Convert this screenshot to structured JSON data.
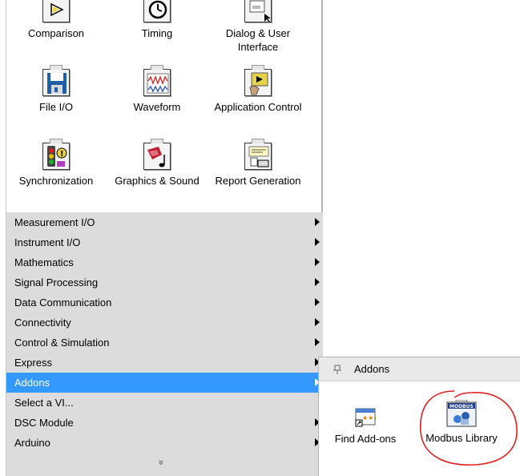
{
  "palette": {
    "tiles": [
      {
        "label": "Comparison",
        "icon": "comparison-icon"
      },
      {
        "label": "Timing",
        "icon": "timing-icon"
      },
      {
        "label": "Dialog & User Interface",
        "icon": "dialog-user-interface-icon"
      },
      {
        "label": "File I/O",
        "icon": "file-io-icon"
      },
      {
        "label": "Waveform",
        "icon": "waveform-icon"
      },
      {
        "label": "Application Control",
        "icon": "application-control-icon"
      },
      {
        "label": "Synchronization",
        "icon": "synchronization-icon"
      },
      {
        "label": "Graphics & Sound",
        "icon": "graphics-sound-icon"
      },
      {
        "label": "Report Generation",
        "icon": "report-generation-icon"
      }
    ],
    "menu_items": [
      {
        "label": "Measurement I/O",
        "has_submenu": true
      },
      {
        "label": "Instrument I/O",
        "has_submenu": true
      },
      {
        "label": "Mathematics",
        "has_submenu": true
      },
      {
        "label": "Signal Processing",
        "has_submenu": true
      },
      {
        "label": "Data Communication",
        "has_submenu": true
      },
      {
        "label": "Connectivity",
        "has_submenu": true
      },
      {
        "label": "Control & Simulation",
        "has_submenu": true
      },
      {
        "label": "Express",
        "has_submenu": true
      },
      {
        "label": "Addons",
        "has_submenu": true,
        "selected": true
      },
      {
        "label": "Select a VI...",
        "has_submenu": false
      },
      {
        "label": "DSC Module",
        "has_submenu": true
      },
      {
        "label": "Arduino",
        "has_submenu": true
      }
    ],
    "more_glyph": "»"
  },
  "addons": {
    "title": "Addons",
    "items": [
      {
        "label": "Find Add-ons",
        "icon": "find-addons-icon"
      },
      {
        "label": "Modbus Library",
        "icon": "modbus-library-icon",
        "icon_text": "MODBUS"
      }
    ]
  },
  "colors": {
    "selection": "#3399ff",
    "menu_bg": "#dcdcdc",
    "annotation": "#e02020"
  }
}
